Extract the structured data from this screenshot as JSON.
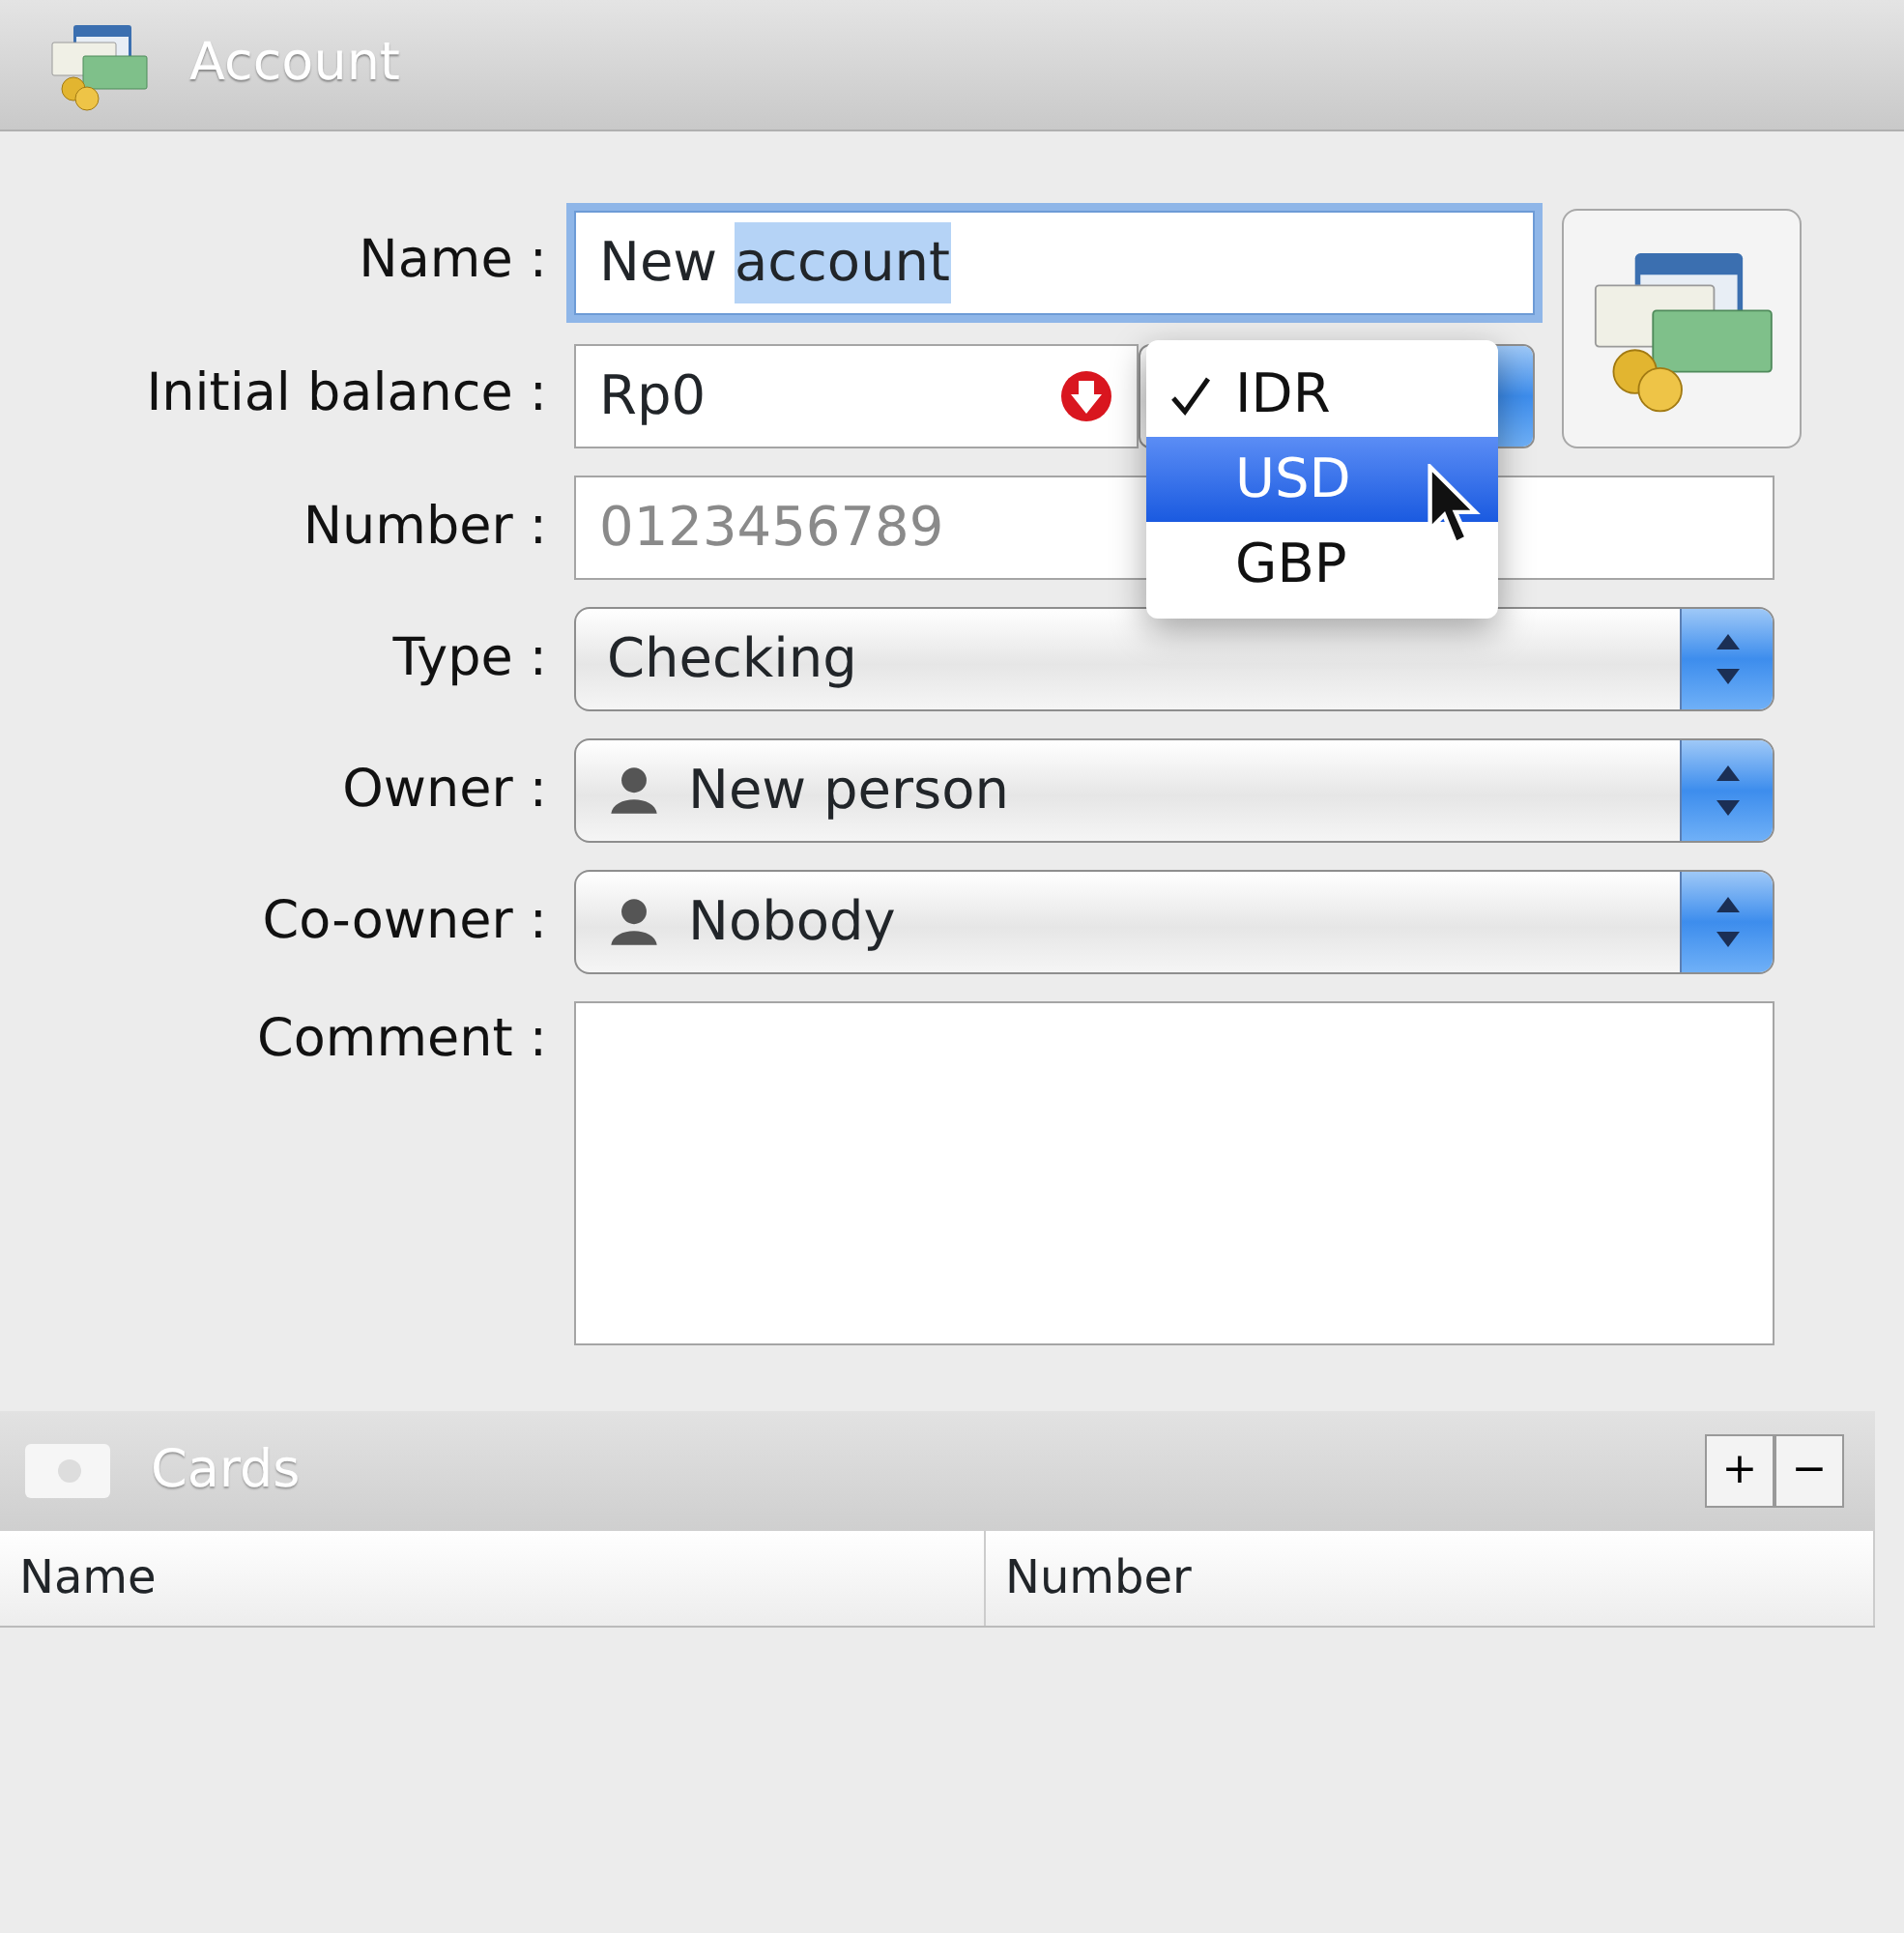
{
  "window": {
    "title": "Account"
  },
  "form": {
    "fields": [
      {
        "kind": "text",
        "label": "Name :",
        "value_before": "New ",
        "value_selected": "account",
        "focused": true
      },
      {
        "kind": "balance",
        "label": "Initial balance :",
        "value": "Rp0",
        "warning": true,
        "currency_menu": {
          "open": true,
          "options": [
            {
              "label": "IDR",
              "checked": true,
              "selected": false
            },
            {
              "label": "USD",
              "checked": false,
              "selected": true
            },
            {
              "label": "GBP",
              "checked": false,
              "selected": false
            }
          ]
        }
      },
      {
        "kind": "text",
        "label": "Number :",
        "placeholder": "0123456789",
        "focused": false
      },
      {
        "kind": "select",
        "label": "Type :",
        "value": "Checking",
        "person": false
      },
      {
        "kind": "select",
        "label": "Owner :",
        "value": "New person",
        "person": true
      },
      {
        "kind": "select",
        "label": "Co-owner :",
        "value": "Nobody",
        "person": true
      },
      {
        "kind": "textarea",
        "label": "Comment :"
      }
    ]
  },
  "cards": {
    "title": "Cards",
    "buttons": [
      "+",
      "−"
    ],
    "columns": [
      "Name",
      "Number"
    ]
  }
}
